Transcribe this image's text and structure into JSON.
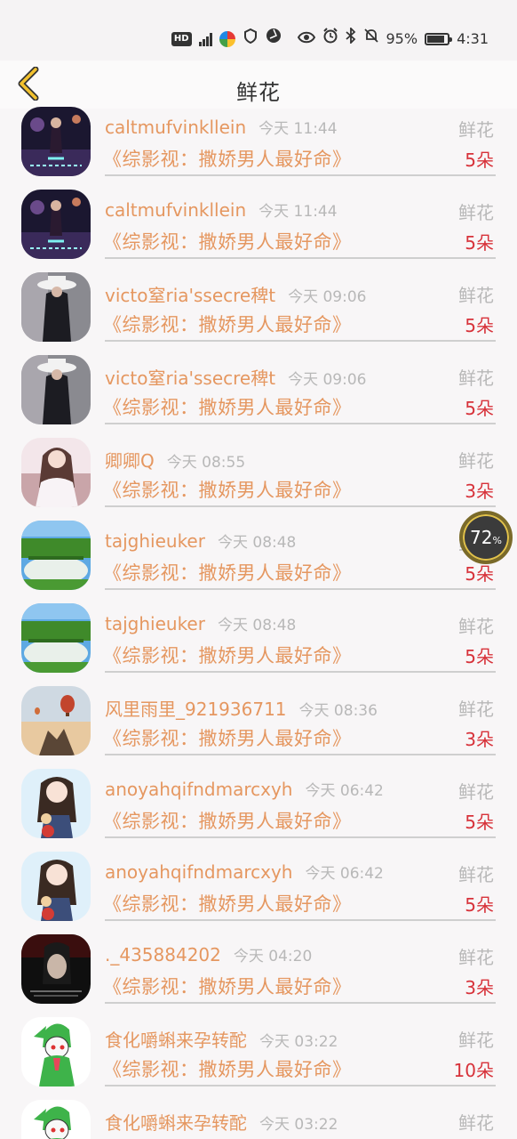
{
  "status_bar": {
    "hd": "HD",
    "network": "5G",
    "battery_percent": "95%",
    "time": "4:31"
  },
  "header": {
    "title": "鲜花",
    "back_icon": "chevron-left-icon",
    "accent": "#f2c12e"
  },
  "float_widget": {
    "value": "72",
    "unit": "%"
  },
  "rows": [
    {
      "name": "caltmufvinkllein",
      "time": "今天 11:44",
      "title": "《综影视：撒娇男人最好命》",
      "gift": "鲜花",
      "count": "5朵",
      "avatar": "night-girl"
    },
    {
      "name": "caltmufvinkllein",
      "time": "今天 11:44",
      "title": "《综影视：撒娇男人最好命》",
      "gift": "鲜花",
      "count": "5朵",
      "avatar": "night-girl"
    },
    {
      "name": "victo窒ria'ssecre稗t",
      "time": "今天 09:06",
      "title": "《综影视：撒娇男人最好命》",
      "gift": "鲜花",
      "count": "5朵",
      "avatar": "hat-girl"
    },
    {
      "name": "victo窒ria'ssecre稗t",
      "time": "今天 09:06",
      "title": "《综影视：撒娇男人最好命》",
      "gift": "鲜花",
      "count": "5朵",
      "avatar": "hat-girl"
    },
    {
      "name": "卿卿Q",
      "time": "今天 08:55",
      "title": "《综影视：撒娇男人最好命》",
      "gift": "鲜花",
      "count": "3朵",
      "avatar": "anime-girl"
    },
    {
      "name": "tajghieuker",
      "time": "今天 08:48",
      "title": "《综影视：撒娇男人最好命》",
      "gift": "鲜花",
      "count": "5朵",
      "avatar": "landscape"
    },
    {
      "name": "tajghieuker",
      "time": "今天 08:48",
      "title": "《综影视：撒娇男人最好命》",
      "gift": "鲜花",
      "count": "5朵",
      "avatar": "landscape"
    },
    {
      "name": "风里雨里_921936711",
      "time": "今天 08:36",
      "title": "《综影视：撒娇男人最好命》",
      "gift": "鲜花",
      "count": "3朵",
      "avatar": "balloon"
    },
    {
      "name": "anoyahqifndmarcxyh",
      "time": "今天 06:42",
      "title": "《综影视：撒娇男人最好命》",
      "gift": "鲜花",
      "count": "5朵",
      "avatar": "cartoon-girl"
    },
    {
      "name": "anoyahqifndmarcxyh",
      "time": "今天 06:42",
      "title": "《综影视：撒娇男人最好命》",
      "gift": "鲜花",
      "count": "5朵",
      "avatar": "cartoon-girl"
    },
    {
      "name": "._435884202",
      "time": "今天 04:20",
      "title": "《综影视：撒娇男人最好命》",
      "gift": "鲜花",
      "count": "3朵",
      "avatar": "dark-portrait"
    },
    {
      "name": "食化嚼蝌来孕转酡",
      "time": "今天 03:22",
      "title": "《综影视：撒娇男人最好命》",
      "gift": "鲜花",
      "count": "10朵",
      "avatar": "green-pokemon"
    },
    {
      "name": "食化嚼蝌来孕转酡",
      "time": "今天 03:22",
      "title": "",
      "gift": "鲜花",
      "count": "",
      "avatar": "green-pokemon"
    }
  ]
}
